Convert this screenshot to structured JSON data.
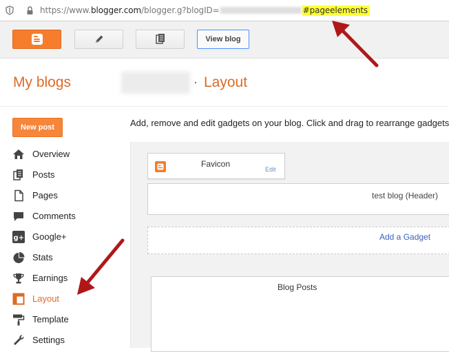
{
  "browser": {
    "url_scheme": "https://www.",
    "url_host": "blogger.com",
    "url_path": "/blogger.g?blogID=",
    "url_hash": "#",
    "url_highlight": "pageelements"
  },
  "toolbar": {
    "view_blog_label": "View blog",
    "blogger_icon": "blogger-logo-icon",
    "pencil_icon": "pencil-icon",
    "pages_icon": "pages-icon"
  },
  "heading": {
    "my_blogs": "My blogs",
    "separator": "·",
    "section": "Layout"
  },
  "sidebar": {
    "new_post_label": "New post",
    "items": [
      {
        "label": "Overview",
        "icon": "home-icon"
      },
      {
        "label": "Posts",
        "icon": "posts-icon"
      },
      {
        "label": "Pages",
        "icon": "page-icon"
      },
      {
        "label": "Comments",
        "icon": "comment-icon"
      },
      {
        "label": "Google+",
        "icon": "google-plus-icon"
      },
      {
        "label": "Stats",
        "icon": "pie-chart-icon"
      },
      {
        "label": "Earnings",
        "icon": "trophy-icon"
      },
      {
        "label": "Layout",
        "icon": "layout-icon",
        "active": true
      },
      {
        "label": "Template",
        "icon": "paint-roller-icon"
      },
      {
        "label": "Settings",
        "icon": "wrench-icon"
      }
    ]
  },
  "main": {
    "description": "Add, remove and edit gadgets on your blog. Click and drag to rearrange gadgets.",
    "favicon_gadget": {
      "title": "Favicon",
      "edit_label": "Edit"
    },
    "header_gadget": {
      "title": "test blog (Header)"
    },
    "add_gadget_label": "Add a Gadget",
    "blog_posts_gadget": {
      "title": "Blog Posts"
    }
  },
  "colors": {
    "accent_orange": "#dd6a27",
    "button_orange": "#f7863b",
    "link_blue": "#3d62b8",
    "highlight_yellow": "#ffff33",
    "arrow_red": "#b01818"
  }
}
